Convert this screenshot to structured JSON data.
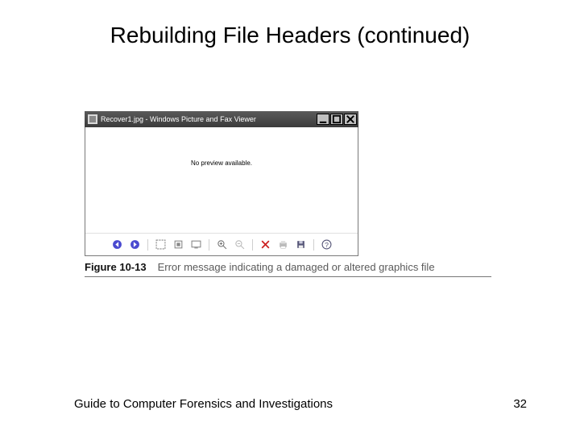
{
  "slide": {
    "title": "Rebuilding File Headers (continued)"
  },
  "window": {
    "titlebar": "Recover1.jpg - Windows Picture and Fax Viewer",
    "message": "No preview available."
  },
  "caption": {
    "label": "Figure 10-13",
    "text": "Error message indicating a damaged or altered graphics file"
  },
  "footer": {
    "book": "Guide to Computer Forensics and Investigations",
    "page": "32"
  }
}
